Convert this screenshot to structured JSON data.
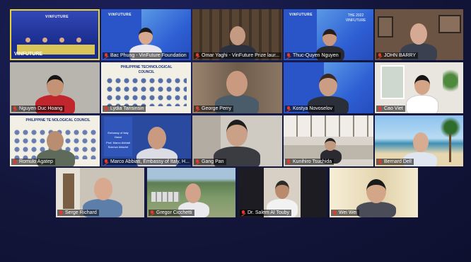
{
  "participants": [
    {
      "name": "VINFUTURE"
    },
    {
      "name": "Bac Phung - VinFuture Foundation"
    },
    {
      "name": "Omar Yaghi - VinFuture Prize laur..."
    },
    {
      "name": "Thuc-Quyen Nguyen"
    },
    {
      "name": "JOHN BARRY"
    },
    {
      "name": "Nguyen Duc Hoang"
    },
    {
      "name": "Lydia Tansinsin"
    },
    {
      "name": "George Perry"
    },
    {
      "name": "Kostya Novoselov"
    },
    {
      "name": "Cao Viet"
    },
    {
      "name": "Romulo Agatep"
    },
    {
      "name": "Marco Abbiati, Embassy of Italy, H..."
    },
    {
      "name": "Gang Pan"
    },
    {
      "name": "Kunihiro Tsuchida"
    },
    {
      "name": "Bernard Dell"
    },
    {
      "name": "Serge Richard"
    },
    {
      "name": "Gregor Cicchetti"
    },
    {
      "name": "Dr. Salem Al Touby"
    },
    {
      "name": "Wei Wei"
    }
  ],
  "vinfuture_banner": {
    "brand": "VINFUTURE",
    "year_title": "THE 2022 VINFUTURE"
  },
  "ptc_banner": {
    "title": "PHILIPPINE TECHNOLOGICAL COUNCIL",
    "title_short": "PHILIPPINE TE     NOLOGICAL COUNCIL"
  },
  "embassy_card": {
    "line1": "Embassy of Italy",
    "line2": "Hanoi",
    "line3": "Prof. Marco Abbiati",
    "line4": "Science Attaché"
  },
  "colors": {
    "background": "#13163a",
    "active_border": "#e6d43a",
    "muted_icon": "#e23a2c",
    "vinfuture_blue": "#1f3fa8"
  }
}
